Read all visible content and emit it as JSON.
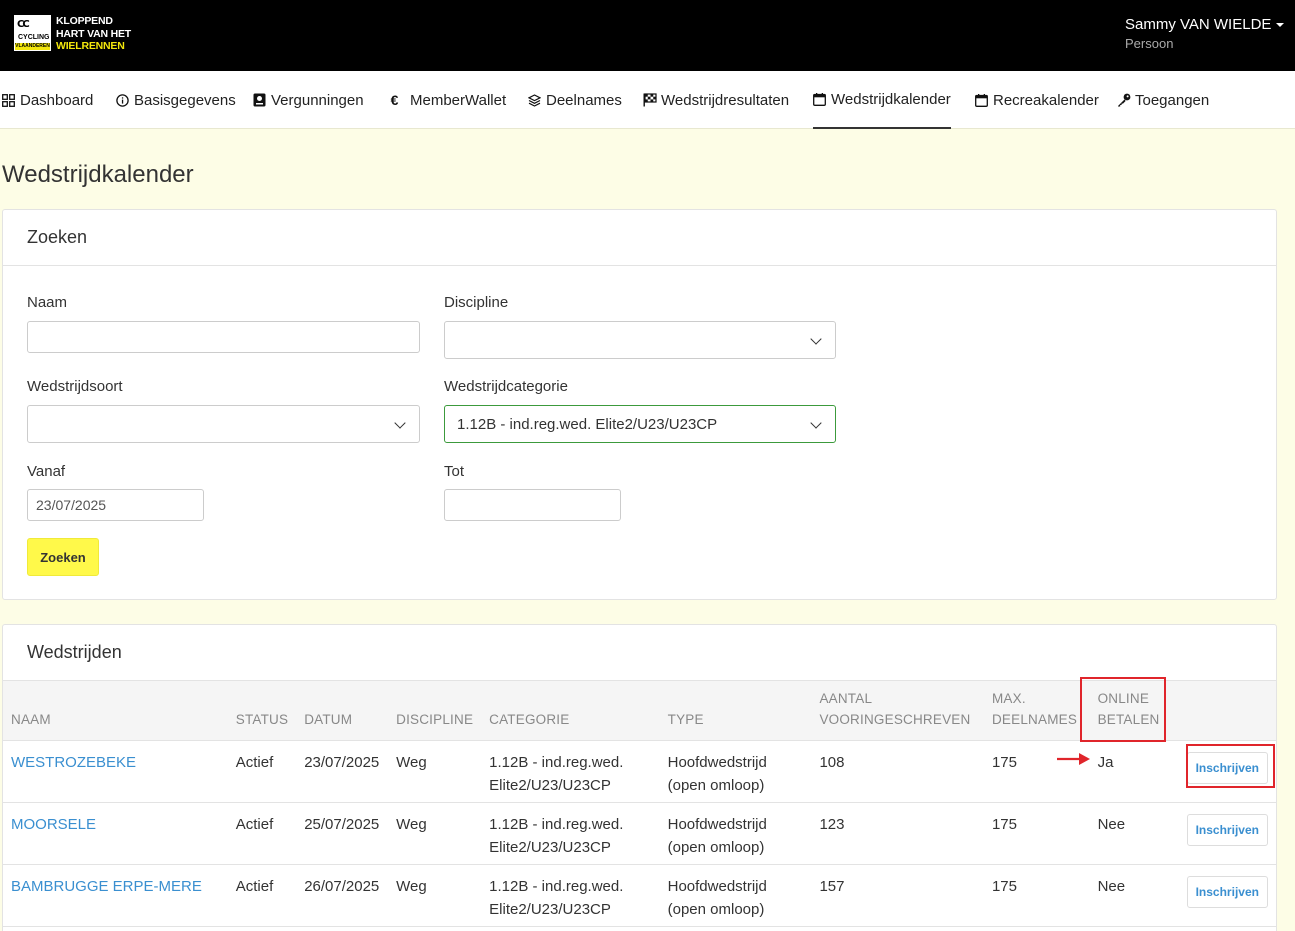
{
  "header": {
    "logo": {
      "line1": "KLOPPEND",
      "line2": "HART VAN HET",
      "line3": "WIELRENNEN",
      "badge_top": "CC",
      "badge_mid": "CYCLING",
      "badge_bottom": "VLAANDEREN"
    },
    "user": {
      "name": "Sammy VAN WIELDE",
      "role": "Persoon"
    }
  },
  "nav": {
    "items": [
      {
        "label": "Dashboard",
        "icon": "grid-icon"
      },
      {
        "label": "Basisgegevens",
        "icon": "info-icon"
      },
      {
        "label": "Vergunningen",
        "icon": "license-icon"
      },
      {
        "label": "MemberWallet",
        "icon": "euro-icon"
      },
      {
        "label": "Deelnames",
        "icon": "layers-icon"
      },
      {
        "label": "Wedstrijdresultaten",
        "icon": "checkered-flag-icon"
      },
      {
        "label": "Wedstrijdkalender",
        "icon": "calendar-icon",
        "active": true
      },
      {
        "label": "Recreakalender",
        "icon": "calendar-icon"
      },
      {
        "label": "Toegangen",
        "icon": "key-icon"
      }
    ]
  },
  "page": {
    "title": "Wedstrijdkalender"
  },
  "search": {
    "title": "Zoeken",
    "naam": {
      "label": "Naam",
      "value": ""
    },
    "discipline": {
      "label": "Discipline",
      "value": ""
    },
    "wedstrijdsoort": {
      "label": "Wedstrijdsoort",
      "value": ""
    },
    "wedstrijdcategorie": {
      "label": "Wedstrijdcategorie",
      "value": "1.12B - ind.reg.wed. Elite2/U23/U23CP"
    },
    "vanaf": {
      "label": "Vanaf",
      "value": "23/07/2025"
    },
    "tot": {
      "label": "Tot",
      "value": ""
    },
    "button": "Zoeken"
  },
  "results": {
    "title": "Wedstrijden",
    "columns": {
      "naam": "NAAM",
      "status": "STATUS",
      "datum": "DATUM",
      "discipline": "DISCIPLINE",
      "categorie": "CATEGORIE",
      "type": "TYPE",
      "aantal_1": "AANTAL",
      "aantal_2": "VOORINGESCHREVEN",
      "max_1": "MAX.",
      "max_2": "DEELNAMES",
      "online_1": "ONLINE",
      "online_2": "BETALEN"
    },
    "rows": [
      {
        "naam": "WESTROZEBEKE",
        "status": "Actief",
        "datum": "23/07/2025",
        "discipline": "Weg",
        "categorie_1": "1.12B - ind.reg.wed.",
        "categorie_2": "Elite2/U23/U23CP",
        "type_1": "Hoofdwedstrijd",
        "type_2": "(open omloop)",
        "aantal": "108",
        "max": "175",
        "online": "Ja",
        "button": "Inschrijven"
      },
      {
        "naam": "MOORSELE",
        "status": "Actief",
        "datum": "25/07/2025",
        "discipline": "Weg",
        "categorie_1": "1.12B - ind.reg.wed.",
        "categorie_2": "Elite2/U23/U23CP",
        "type_1": "Hoofdwedstrijd",
        "type_2": "(open omloop)",
        "aantal": "123",
        "max": "175",
        "online": "Nee",
        "button": "Inschrijven"
      },
      {
        "naam": "BAMBRUGGE ERPE-MERE",
        "status": "Actief",
        "datum": "26/07/2025",
        "discipline": "Weg",
        "categorie_1": "1.12B - ind.reg.wed.",
        "categorie_2": "Elite2/U23/U23CP",
        "type_1": "Hoofdwedstrijd",
        "type_2": "(open omloop)",
        "aantal": "157",
        "max": "175",
        "online": "Nee",
        "button": "Inschrijven"
      }
    ]
  },
  "colors": {
    "accent_yellow": "#fff94a",
    "link_blue": "#3a8fd0",
    "annotation_red": "#e0252b",
    "page_bg": "#fdfde6"
  }
}
